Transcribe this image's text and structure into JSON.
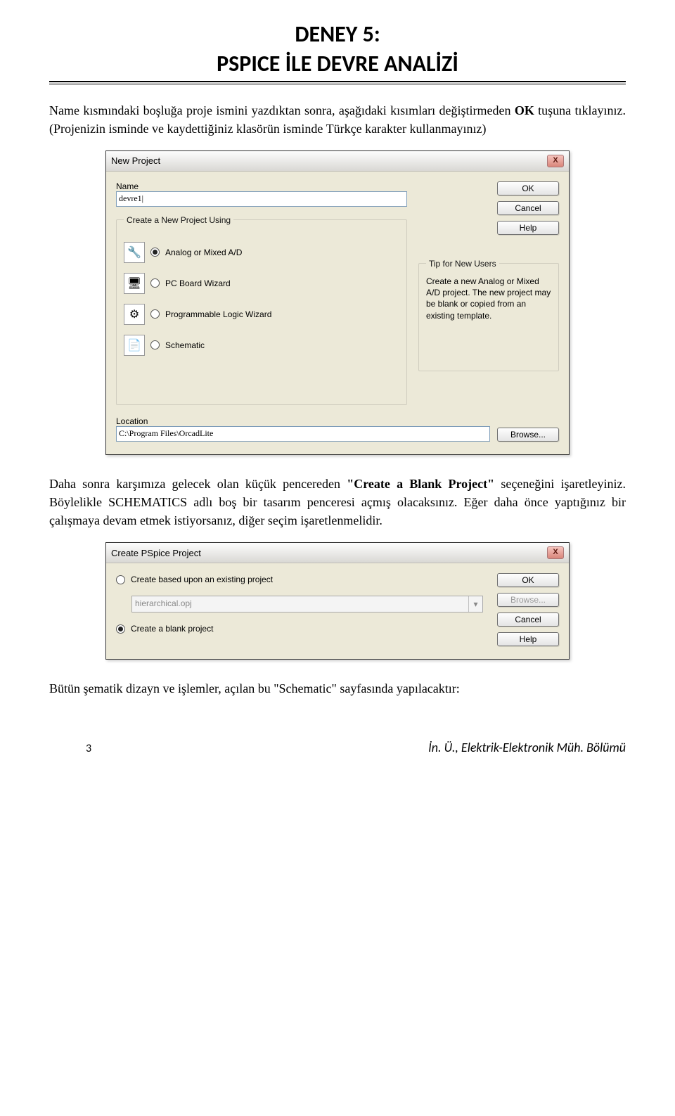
{
  "page": {
    "title_l1": "DENEY 5:",
    "title_l2": "PSPICE İLE DEVRE ANALİZİ",
    "para1_a": "Name kısmındaki boşluğa proje ismini yazdıktan sonra, aşağıdaki kısımları değiştirmeden ",
    "para1_bold": "OK",
    "para1_b": " tuşuna tıklayınız. (Projenizin isminde ve kaydettiğiniz klasörün isminde Türkçe karakter kullanmayınız)",
    "para2_a": "Daha sonra karşımıza gelecek olan küçük pencereden ",
    "para2_bold": "\"Create a Blank Project\"",
    "para2_b": " seçeneğini işaretleyiniz. Böylelikle SCHEMATICS adlı boş bir tasarım penceresi açmış olacaksınız. Eğer daha önce yaptığınız bir çalışmaya devam etmek istiyorsanız, diğer seçim işaretlenmelidir.",
    "para3": "Bütün şematik dizayn ve işlemler, açılan bu \"Schematic\" sayfasında yapılacaktır:",
    "footer": "İn. Ü., Elektrik-Elektronik Müh. Bölümü",
    "page_number": "3"
  },
  "dialog1": {
    "title": "New Project",
    "close": "X",
    "name_label": "Name",
    "name_value": "devre1|",
    "group_label": "Create a New Project Using",
    "opt1_label": "Analog or Mixed A/D",
    "opt1_icon": "🔧",
    "opt2_label": "PC Board Wizard",
    "opt2_icon": "🖥",
    "opt3_label": "Programmable Logic Wizard",
    "opt3_icon": "⚙",
    "opt4_label": "Schematic",
    "opt4_icon": "📄",
    "btn_ok": "OK",
    "btn_cancel": "Cancel",
    "btn_help": "Help",
    "tip_label": "Tip for New Users",
    "tip_text": "Create a new Analog or Mixed A/D project.  The new project may be blank or copied from an existing template.",
    "location_label": "Location",
    "location_value": "C:\\Program Files\\OrcadLite",
    "btn_browse": "Browse..."
  },
  "dialog2": {
    "title": "Create PSpice Project",
    "close": "X",
    "opt_existing": "Create based upon an existing project",
    "existing_value": "hierarchical.opj",
    "opt_blank": "Create a blank project",
    "btn_ok": "OK",
    "btn_browse": "Browse...",
    "btn_cancel": "Cancel",
    "btn_help": "Help"
  }
}
